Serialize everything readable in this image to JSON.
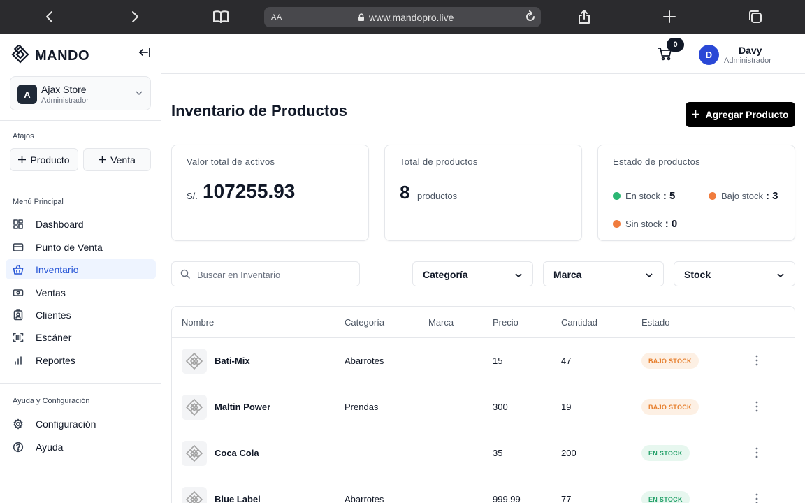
{
  "browser": {
    "aa_label": "AA",
    "url": "www.mandopro.live"
  },
  "sidebar": {
    "brand": "MANDO",
    "store": {
      "initial": "A",
      "name": "Ajax Store",
      "role": "Administrador"
    },
    "shortcuts_label": "Atajos",
    "shortcuts": [
      {
        "label": "Producto"
      },
      {
        "label": "Venta"
      }
    ],
    "main_menu_label": "Menú Principal",
    "main_menu": [
      {
        "label": "Dashboard",
        "icon": "dashboard-icon"
      },
      {
        "label": "Punto de Venta",
        "icon": "credit-card-icon"
      },
      {
        "label": "Inventario",
        "icon": "basket-icon",
        "active": true
      },
      {
        "label": "Ventas",
        "icon": "money-icon"
      },
      {
        "label": "Clientes",
        "icon": "contact-icon"
      },
      {
        "label": "Escáner",
        "icon": "scan-icon"
      },
      {
        "label": "Reportes",
        "icon": "bar-chart-icon"
      }
    ],
    "help_label": "Ayuda y Configuración",
    "help_menu": [
      {
        "label": "Configuración",
        "icon": "gear-icon"
      },
      {
        "label": "Ayuda",
        "icon": "help-circle-icon"
      }
    ]
  },
  "topbar": {
    "cart_count": "0",
    "user_initial": "D",
    "user_name": "Davy",
    "user_role": "Administrador"
  },
  "main": {
    "title": "Inventario de Productos",
    "add_button": "Agregar Producto",
    "cards": {
      "assets": {
        "title": "Valor total de activos",
        "currency": "S/.",
        "value": "107255.93"
      },
      "products": {
        "title": "Total de productos",
        "value": "8",
        "unit": "productos"
      },
      "status": {
        "title": "Estado de productos",
        "in_stock_label": "En stock",
        "in_stock_value": ": 5",
        "low_stock_label": "Bajo stock",
        "low_stock_value": ": 3",
        "no_stock_label": "Sin stock",
        "no_stock_value": ": 0"
      }
    },
    "search_placeholder": "Buscar en Inventario",
    "filters": [
      "Categoría",
      "Marca",
      "Stock"
    ],
    "table": {
      "columns": [
        "Nombre",
        "Categoría",
        "Marca",
        "Precio",
        "Cantidad",
        "Estado"
      ],
      "rows": [
        {
          "name": "Bati-Mix",
          "category": "Abarrotes",
          "brand": "",
          "price": "15",
          "qty": "47",
          "status": "BAJO STOCK",
          "status_type": "low"
        },
        {
          "name": "Maltin Power",
          "category": "Prendas",
          "brand": "",
          "price": "300",
          "qty": "19",
          "status": "BAJO STOCK",
          "status_type": "low"
        },
        {
          "name": "Coca Cola",
          "category": "",
          "brand": "",
          "price": "35",
          "qty": "200",
          "status": "EN STOCK",
          "status_type": "ok"
        },
        {
          "name": "Blue Label",
          "category": "Abarrotes",
          "brand": "",
          "price": "999.99",
          "qty": "77",
          "status": "EN STOCK",
          "status_type": "ok"
        }
      ]
    }
  },
  "colors": {
    "accent": "#2554d6",
    "active_bg": "#eef4ff",
    "in_stock": "#2bb673",
    "low_stock": "#f07c3d",
    "no_stock": "#f07c3d",
    "primary_button": "#000000"
  }
}
